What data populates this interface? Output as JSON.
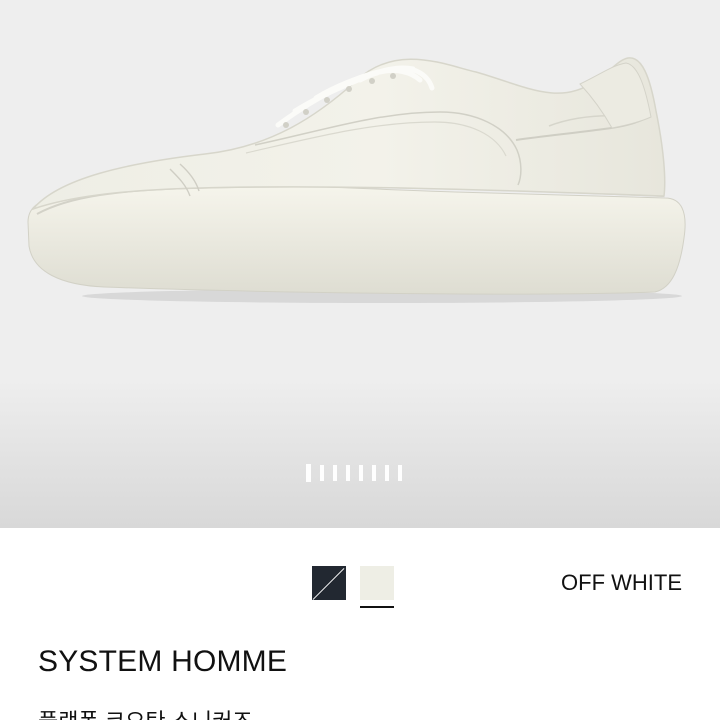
{
  "gallery": {
    "image_alt": "off-white leather platform sneaker",
    "slide_count": 8,
    "active_slide": 1
  },
  "colors": {
    "options": [
      {
        "name": "dark",
        "hex": "#222831"
      },
      {
        "name": "off-white",
        "hex": "#eeeee5"
      }
    ],
    "selected_label": "OFF WHITE"
  },
  "product": {
    "brand": "SYSTEM HOMME",
    "name": "플랫폼 코오탄 스니커즈"
  }
}
